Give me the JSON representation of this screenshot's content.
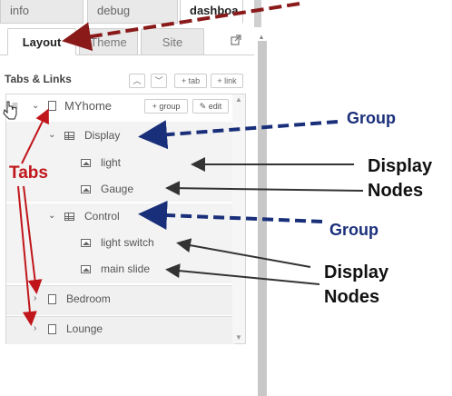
{
  "top_tabs": [
    "info",
    "debug",
    "dashboa"
  ],
  "sub_tabs": [
    "Layout",
    "Theme",
    "Site"
  ],
  "section": {
    "title": "Tabs & Links",
    "buttons": [
      "+ tab",
      "+ link"
    ]
  },
  "tree": {
    "home_tab": {
      "label": "MYhome",
      "add_group_label": "+ group",
      "edit_label": "edit"
    },
    "groups": [
      {
        "label": "Display",
        "nodes": [
          "light",
          "Gauge"
        ]
      },
      {
        "label": "Control",
        "nodes": [
          "light switch",
          "main slide"
        ]
      }
    ],
    "other_tabs": [
      "Bedroom",
      "Lounge"
    ]
  },
  "annotations": {
    "tabs": "Tabs",
    "group_1": "Group",
    "group_2": "Group",
    "display_nodes_1": [
      "Display",
      "Nodes"
    ],
    "display_nodes_2": [
      "Display",
      "Nodes"
    ]
  },
  "colors": {
    "annotation_red": "#c0161b",
    "annotation_blue": "#1a2f7a",
    "arrow_darkred": "#8a1a1a",
    "arrow_black": "#333333"
  }
}
